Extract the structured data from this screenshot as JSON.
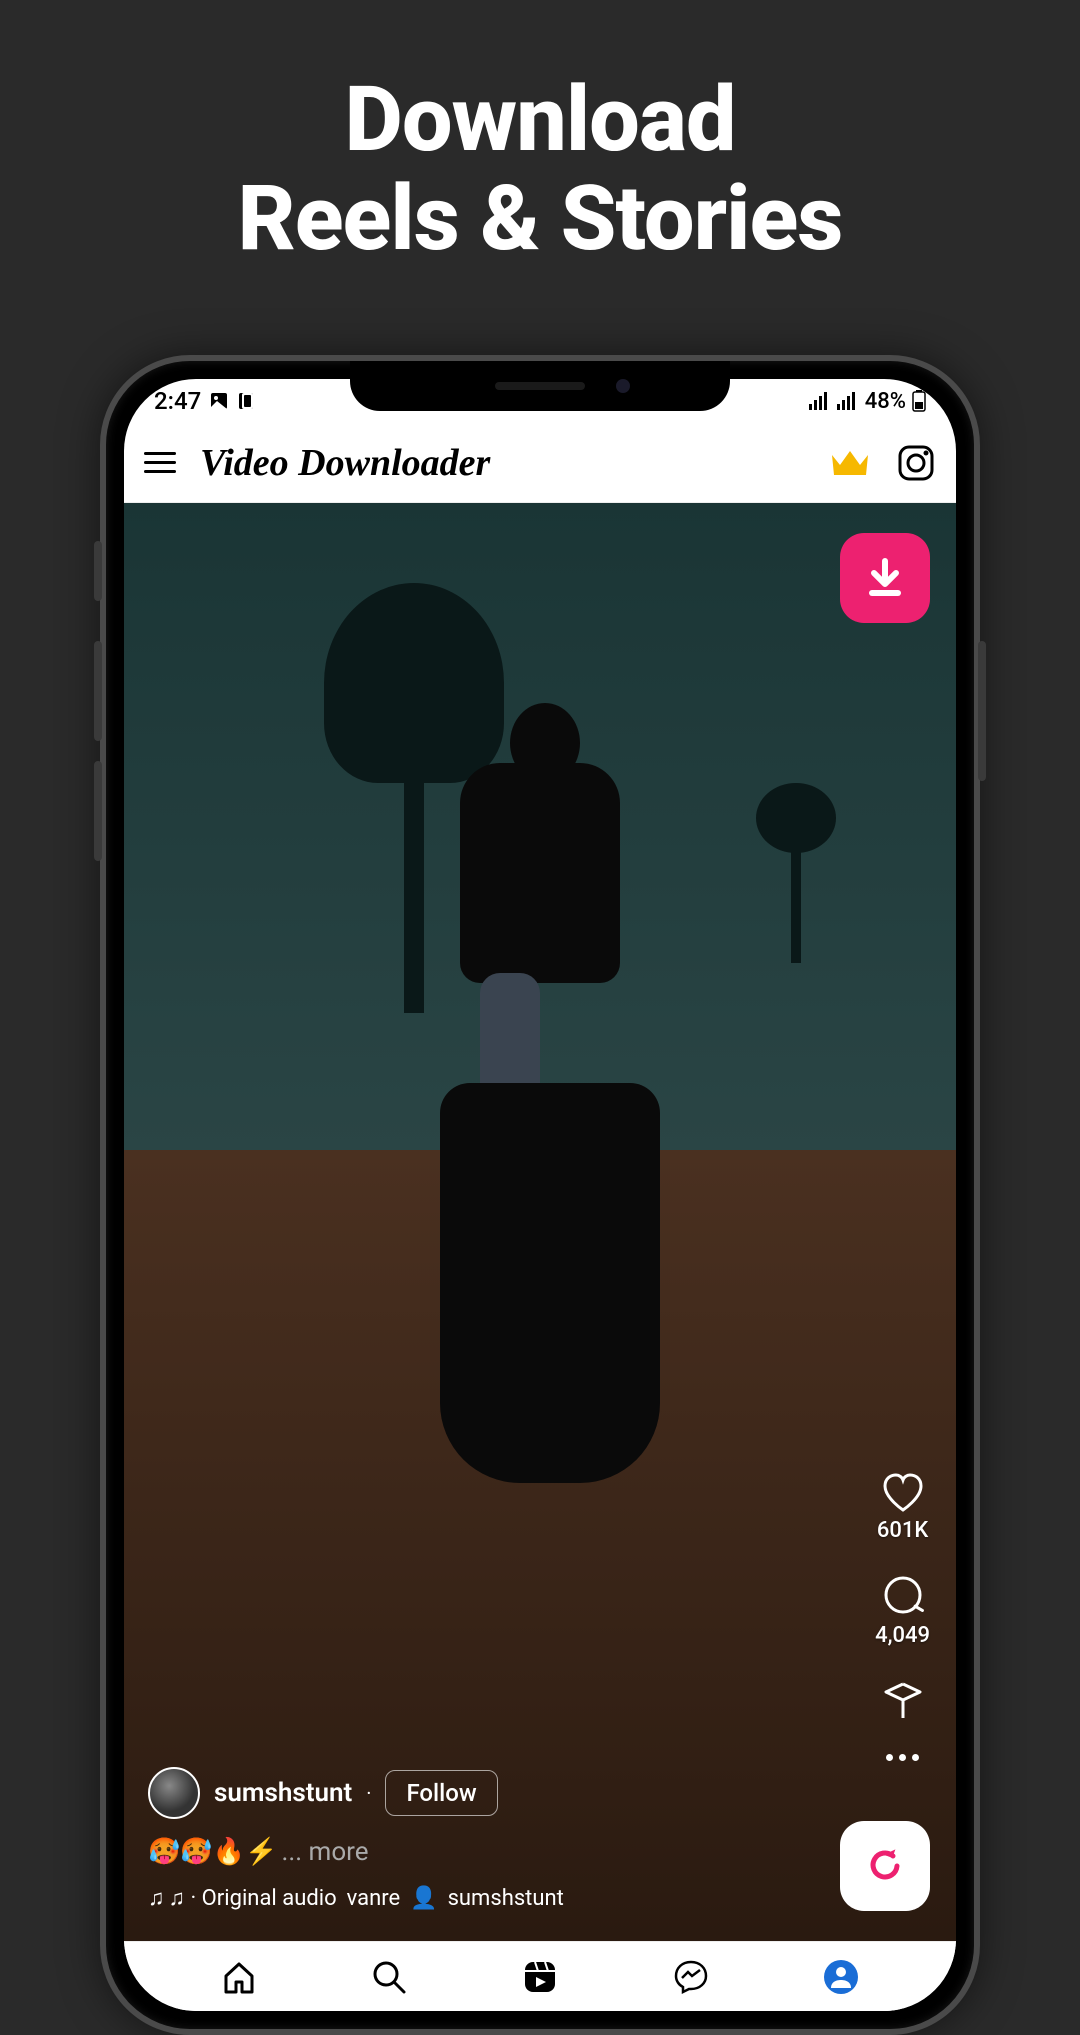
{
  "promo": {
    "line1": "Download",
    "line2": "Reels & Stories"
  },
  "status_bar": {
    "time": "2:47",
    "battery": "48%"
  },
  "header": {
    "title": "Video Downloader"
  },
  "video": {
    "username": "sumshstunt",
    "follow_label": "Follow",
    "caption_emoji": "🥵🥵🔥⚡",
    "caption_more": "... more",
    "audio_prefix": "♫ · Original audio",
    "audio_artist": "vanre",
    "person_icon": "👤",
    "audio_user": "sumshstunt",
    "likes": "601K",
    "comments": "4,049"
  },
  "colors": {
    "accent_pink": "#ed2170",
    "crown": "#f6b800",
    "nav_active": "#1a6dd6"
  }
}
